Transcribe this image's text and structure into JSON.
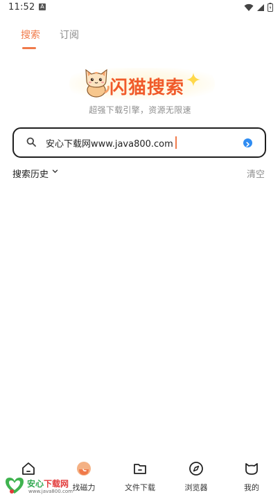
{
  "status_bar": {
    "time": "11:52",
    "notification_badge": "A"
  },
  "tabs": [
    {
      "label": "搜索",
      "active": true
    },
    {
      "label": "订阅",
      "active": false
    }
  ],
  "logo": {
    "title": "闪猫搜索",
    "subtitle": "超强下载引擎，资源无限速"
  },
  "search": {
    "value": "安心下载网www.java800.com",
    "placeholder": ""
  },
  "history": {
    "label": "搜索历史",
    "clear_label": "清空"
  },
  "bottom_nav": [
    {
      "label": "",
      "icon": "home-icon"
    },
    {
      "label": "找磁力",
      "icon": "magnet-icon"
    },
    {
      "label": "文件下载",
      "icon": "folder-icon"
    },
    {
      "label": "浏览器",
      "icon": "compass-icon"
    },
    {
      "label": "我的",
      "icon": "cat-face-icon"
    }
  ],
  "watermark": {
    "name_part1": "安心",
    "name_part2": "下载网",
    "url": "www.java800.com"
  },
  "colors": {
    "accent": "#f07a4a",
    "brand_title": "#f05a2a",
    "go_button": "#2f8cf2",
    "muted_text": "#8e8e8e"
  }
}
